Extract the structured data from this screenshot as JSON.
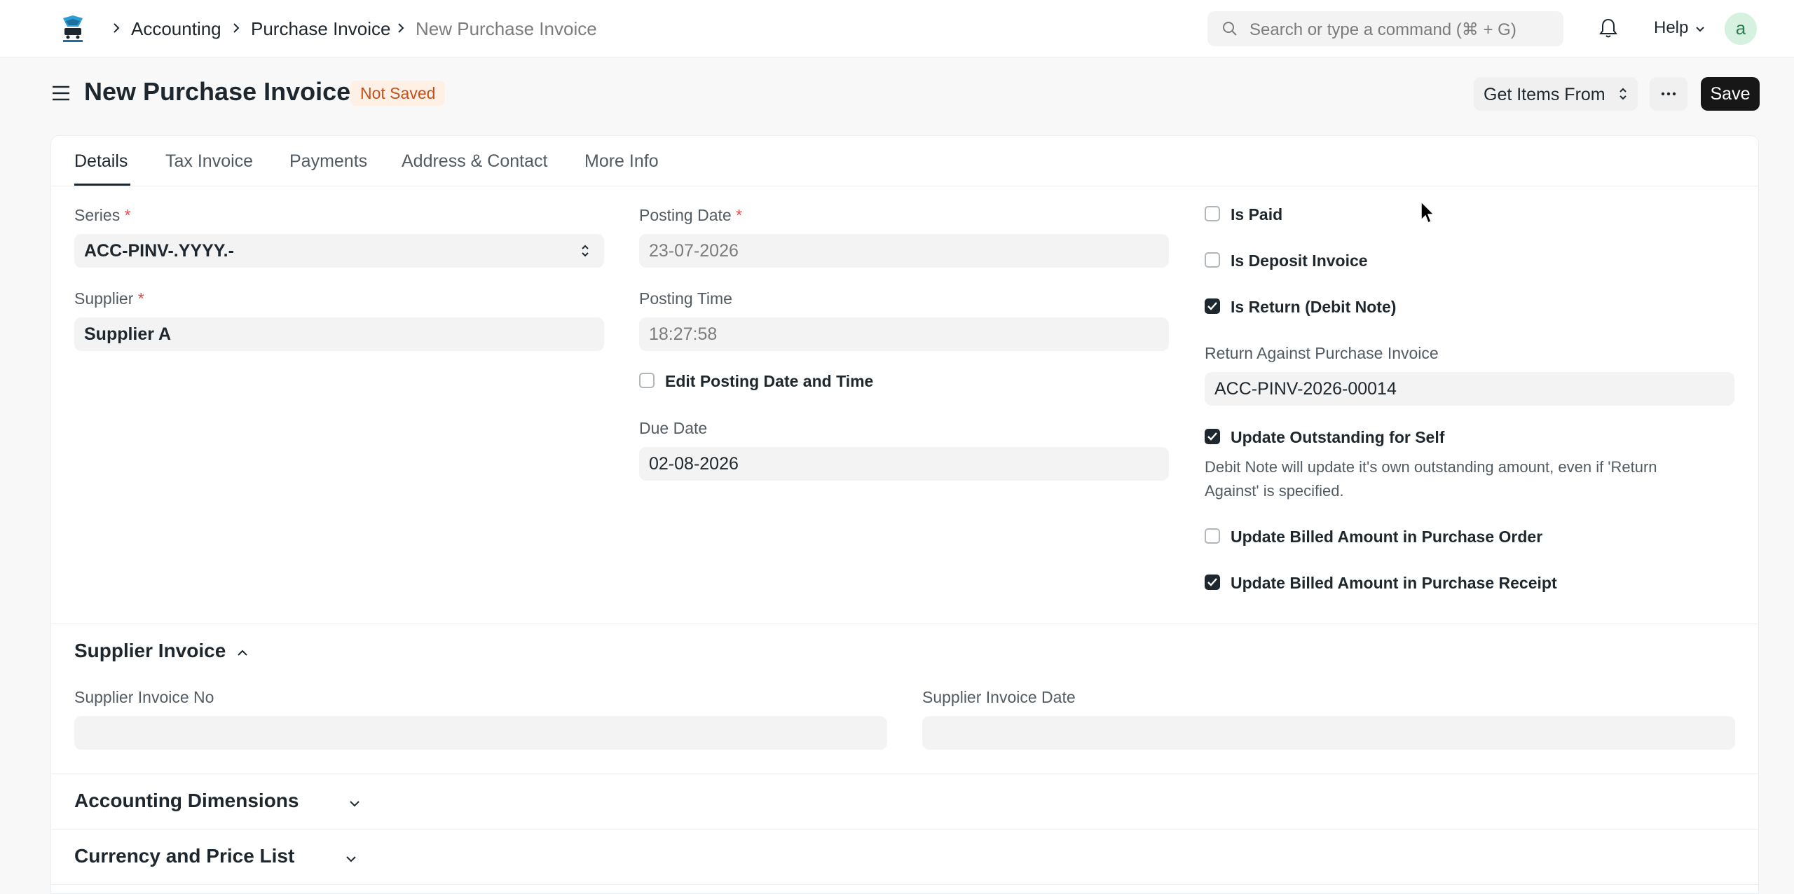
{
  "navbar": {
    "breadcrumbs": [
      "Accounting",
      "Purchase Invoice",
      "New Purchase Invoice"
    ],
    "search_placeholder": "Search or type a command (⌘ + G)",
    "help_label": "Help",
    "avatar_letter": "a"
  },
  "page": {
    "title": "New Purchase Invoice",
    "status": "Not Saved",
    "get_items_label": "Get Items From",
    "save_label": "Save"
  },
  "tabs": [
    "Details",
    "Tax Invoice",
    "Payments",
    "Address & Contact",
    "More Info"
  ],
  "details": {
    "series_label": "Series",
    "series_value": "ACC-PINV-.YYYY.-",
    "supplier_label": "Supplier",
    "supplier_value": "Supplier A",
    "posting_date_label": "Posting Date",
    "posting_date_value": "23-07-2026",
    "posting_time_label": "Posting Time",
    "posting_time_value": "18:27:58",
    "edit_posting_label": "Edit Posting Date and Time",
    "edit_posting_checked": false,
    "due_date_label": "Due Date",
    "due_date_value": "02-08-2026",
    "is_paid_label": "Is Paid",
    "is_paid_checked": false,
    "is_deposit_label": "Is Deposit Invoice",
    "is_deposit_checked": false,
    "is_return_label": "Is Return (Debit Note)",
    "is_return_checked": true,
    "return_against_label": "Return Against Purchase Invoice",
    "return_against_value": "ACC-PINV-2026-00014",
    "update_outstanding_label": "Update Outstanding for Self",
    "update_outstanding_checked": true,
    "update_outstanding_desc_1": "Debit Note will update it's own outstanding amount, even if 'Return",
    "update_outstanding_desc_2": "Against' is specified.",
    "update_billed_po_label": "Update Billed Amount in Purchase Order",
    "update_billed_po_checked": false,
    "update_billed_pr_label": "Update Billed Amount in Purchase Receipt",
    "update_billed_pr_checked": true
  },
  "supplier_invoice": {
    "title": "Supplier Invoice",
    "no_label": "Supplier Invoice No",
    "no_value": "",
    "date_label": "Supplier Invoice Date",
    "date_value": ""
  },
  "sections": {
    "accounting_dimensions": "Accounting Dimensions",
    "currency_price_list": "Currency and Price List"
  }
}
